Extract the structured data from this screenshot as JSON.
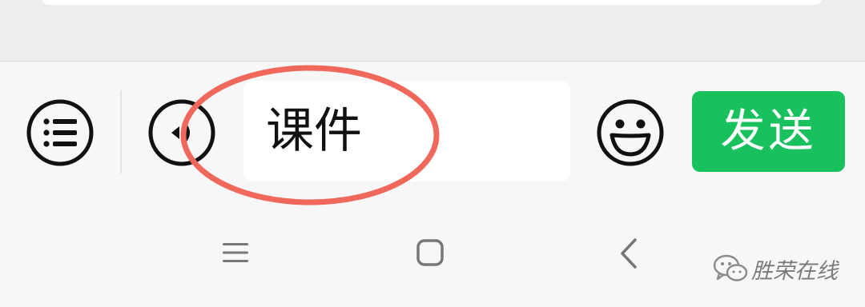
{
  "chat_input": {
    "text": "课件"
  },
  "toolbar": {
    "menu_icon": "list-menu-icon",
    "voice_icon": "voice-input-icon",
    "emoji_icon": "emoji-icon",
    "send_label": "发送"
  },
  "navbar": {
    "recents_icon": "recents-icon",
    "home_icon": "home-icon",
    "back_icon": "back-icon"
  },
  "watermark": {
    "text": "胜荣在线"
  },
  "colors": {
    "send_button": "#19c15e",
    "annotation_circle": "#f0675b",
    "background": "#f7f7f7"
  }
}
